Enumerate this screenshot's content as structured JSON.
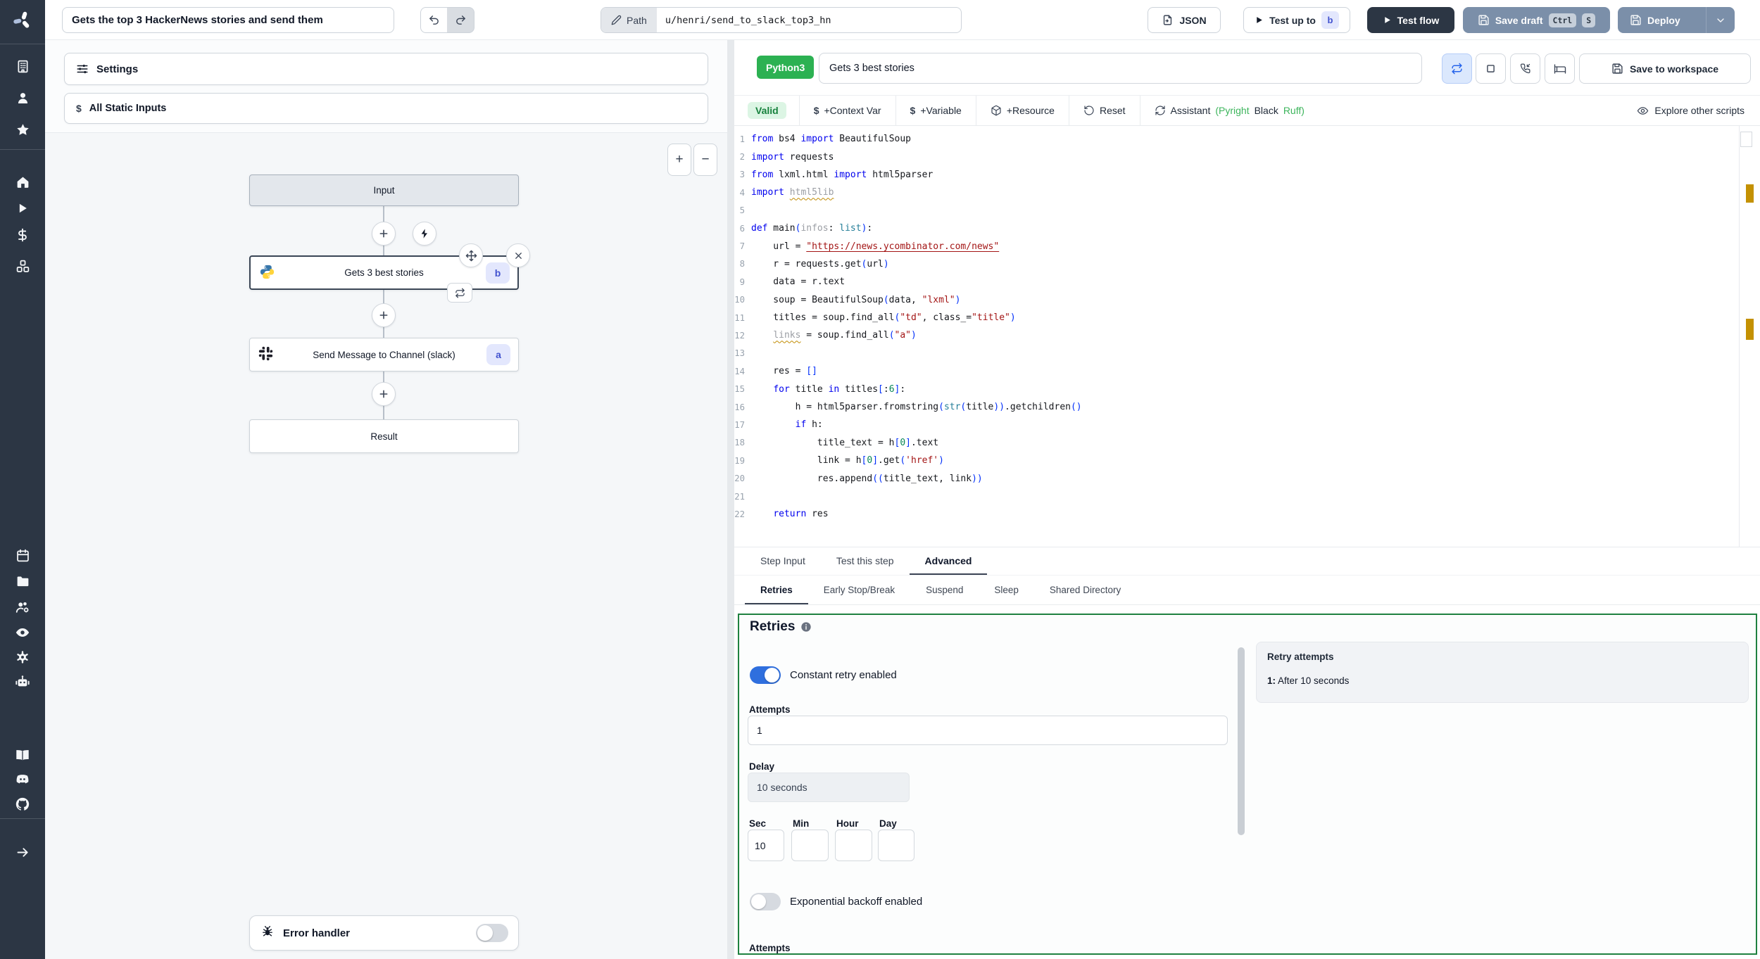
{
  "topbar": {
    "flow_title": "Gets the top 3 HackerNews stories and send them",
    "path_label": "Path",
    "path_value": "u/henri/send_to_slack_top3_hn",
    "json_label": "JSON",
    "test_up_to_label": "Test up to",
    "test_up_to_badge": "b",
    "test_flow_label": "Test flow",
    "save_draft_label": "Save draft",
    "kbd_ctrl": "Ctrl",
    "kbd_s": "S",
    "deploy_label": "Deploy"
  },
  "left_panel": {
    "settings_label": "Settings",
    "static_inputs_label": "All Static Inputs",
    "dollar_glyph": "$",
    "zoom_in": "+",
    "zoom_out": "−",
    "graph": {
      "input_label": "Input",
      "step_b_name": "Gets 3 best stories",
      "step_b_badge": "b",
      "step_a_name": "Send Message to Channel (slack)",
      "step_a_badge": "a",
      "result_label": "Result",
      "error_handler_label": "Error handler"
    }
  },
  "script_panel": {
    "language_badge": "Python3",
    "step_title": "Gets 3 best stories",
    "save_to_workspace_label": "Save to workspace",
    "toolbar": {
      "valid_label": "Valid",
      "dollar": "$",
      "context_var_label": "+Context Var",
      "variable_label": "+Variable",
      "resource_label": "+Resource",
      "reset_label": "Reset",
      "assistant_label": "Assistant",
      "assistant_pyright": "(Pyright",
      "assistant_black": "Black",
      "assistant_ruff": "Ruff)",
      "explore_label": "Explore other scripts"
    },
    "code": {
      "lines": [
        [
          [
            "k",
            "from"
          ],
          [
            "p",
            " bs4 "
          ],
          [
            "k",
            "import"
          ],
          [
            "p",
            " BeautifulSoup"
          ]
        ],
        [
          [
            "k",
            "import"
          ],
          [
            "p",
            " requests"
          ]
        ],
        [
          [
            "k",
            "from"
          ],
          [
            "p",
            " lxml.html "
          ],
          [
            "k",
            "import"
          ],
          [
            "p",
            " html5parser"
          ]
        ],
        [
          [
            "k",
            "import"
          ],
          [
            "p",
            " "
          ],
          [
            "gw",
            "html5lib"
          ]
        ],
        [],
        [
          [
            "k",
            "def"
          ],
          [
            "p",
            " main"
          ],
          [
            "b",
            "("
          ],
          [
            "g",
            "infos"
          ],
          [
            "p",
            ": "
          ],
          [
            "t",
            "list"
          ],
          [
            "b",
            ")"
          ],
          [
            "p",
            ":"
          ]
        ],
        [
          [
            "p",
            "    url = "
          ],
          [
            "su",
            "\"https://news.ycombinator.com/news\""
          ]
        ],
        [
          [
            "p",
            "    r = requests.get"
          ],
          [
            "b",
            "("
          ],
          [
            "p",
            "url"
          ],
          [
            "b",
            ")"
          ]
        ],
        [
          [
            "p",
            "    data = r.text"
          ]
        ],
        [
          [
            "p",
            "    soup = BeautifulSoup"
          ],
          [
            "b",
            "("
          ],
          [
            "p",
            "data, "
          ],
          [
            "s",
            "\"lxml\""
          ],
          [
            "b",
            ")"
          ]
        ],
        [
          [
            "p",
            "    titles = soup.find_all"
          ],
          [
            "b",
            "("
          ],
          [
            "s",
            "\"td\""
          ],
          [
            "p",
            ", class_="
          ],
          [
            "s",
            "\"title\""
          ],
          [
            "b",
            ")"
          ]
        ],
        [
          [
            "p",
            "    "
          ],
          [
            "gw",
            "links"
          ],
          [
            "p",
            " = soup.find_all"
          ],
          [
            "b",
            "("
          ],
          [
            "s",
            "\"a\""
          ],
          [
            "b",
            ")"
          ]
        ],
        [],
        [
          [
            "p",
            "    res = "
          ],
          [
            "b",
            "[]"
          ]
        ],
        [
          [
            "p",
            "    "
          ],
          [
            "k",
            "for"
          ],
          [
            "p",
            " title "
          ],
          [
            "k",
            "in"
          ],
          [
            "p",
            " titles"
          ],
          [
            "b",
            "["
          ],
          [
            "p",
            ":"
          ],
          [
            "n",
            "6"
          ],
          [
            "b",
            "]"
          ],
          [
            "p",
            ":"
          ]
        ],
        [
          [
            "p",
            "        h = html5parser.fromstring"
          ],
          [
            "b",
            "("
          ],
          [
            "t",
            "str"
          ],
          [
            "b",
            "("
          ],
          [
            "p",
            "title"
          ],
          [
            "b",
            "))"
          ],
          [
            "p",
            ".getchildren"
          ],
          [
            "b",
            "()"
          ]
        ],
        [
          [
            "p",
            "        "
          ],
          [
            "k",
            "if"
          ],
          [
            "p",
            " h:"
          ]
        ],
        [
          [
            "p",
            "            title_text = h"
          ],
          [
            "b",
            "["
          ],
          [
            "n",
            "0"
          ],
          [
            "b",
            "]"
          ],
          [
            "p",
            ".text"
          ]
        ],
        [
          [
            "p",
            "            link = h"
          ],
          [
            "b",
            "["
          ],
          [
            "n",
            "0"
          ],
          [
            "b",
            "]"
          ],
          [
            "p",
            ".get"
          ],
          [
            "b",
            "("
          ],
          [
            "s",
            "'href'"
          ],
          [
            "b",
            ")"
          ]
        ],
        [
          [
            "p",
            "            res.append"
          ],
          [
            "b",
            "(("
          ],
          [
            "p",
            "title_text, link"
          ],
          [
            "b",
            "))"
          ]
        ],
        [],
        [
          [
            "p",
            "    "
          ],
          [
            "k",
            "return"
          ],
          [
            "p",
            " res"
          ]
        ]
      ]
    }
  },
  "tabs": {
    "main": [
      "Step Input",
      "Test this step",
      "Advanced"
    ],
    "sub": [
      "Retries",
      "Early Stop/Break",
      "Suspend",
      "Sleep",
      "Shared Directory"
    ]
  },
  "retries": {
    "heading": "Retries",
    "constant_toggle_label": "Constant retry enabled",
    "constant_enabled": true,
    "attempts_label": "Attempts",
    "attempts_value": "1",
    "delay_label": "Delay",
    "delay_value": "10 seconds",
    "sec_label": "Sec",
    "min_label": "Min",
    "hour_label": "Hour",
    "day_label": "Day",
    "sec_value": "10",
    "backoff_toggle_label": "Exponential backoff enabled",
    "backoff_enabled": false,
    "attempts2_label": "Attempts",
    "summary_title": "Retry attempts",
    "summary_index": "1:",
    "summary_text": "After 10 seconds"
  },
  "colors": {
    "sidebar_dark": "#2c3644",
    "accent_green_border": "#1f8140",
    "python_badge_green": "#2cb152",
    "toggle_on_blue": "#2f6fde",
    "badge_indigo_bg": "#e3e7fd",
    "badge_indigo_text": "#4353cf",
    "warning_marker": "#c49102"
  }
}
